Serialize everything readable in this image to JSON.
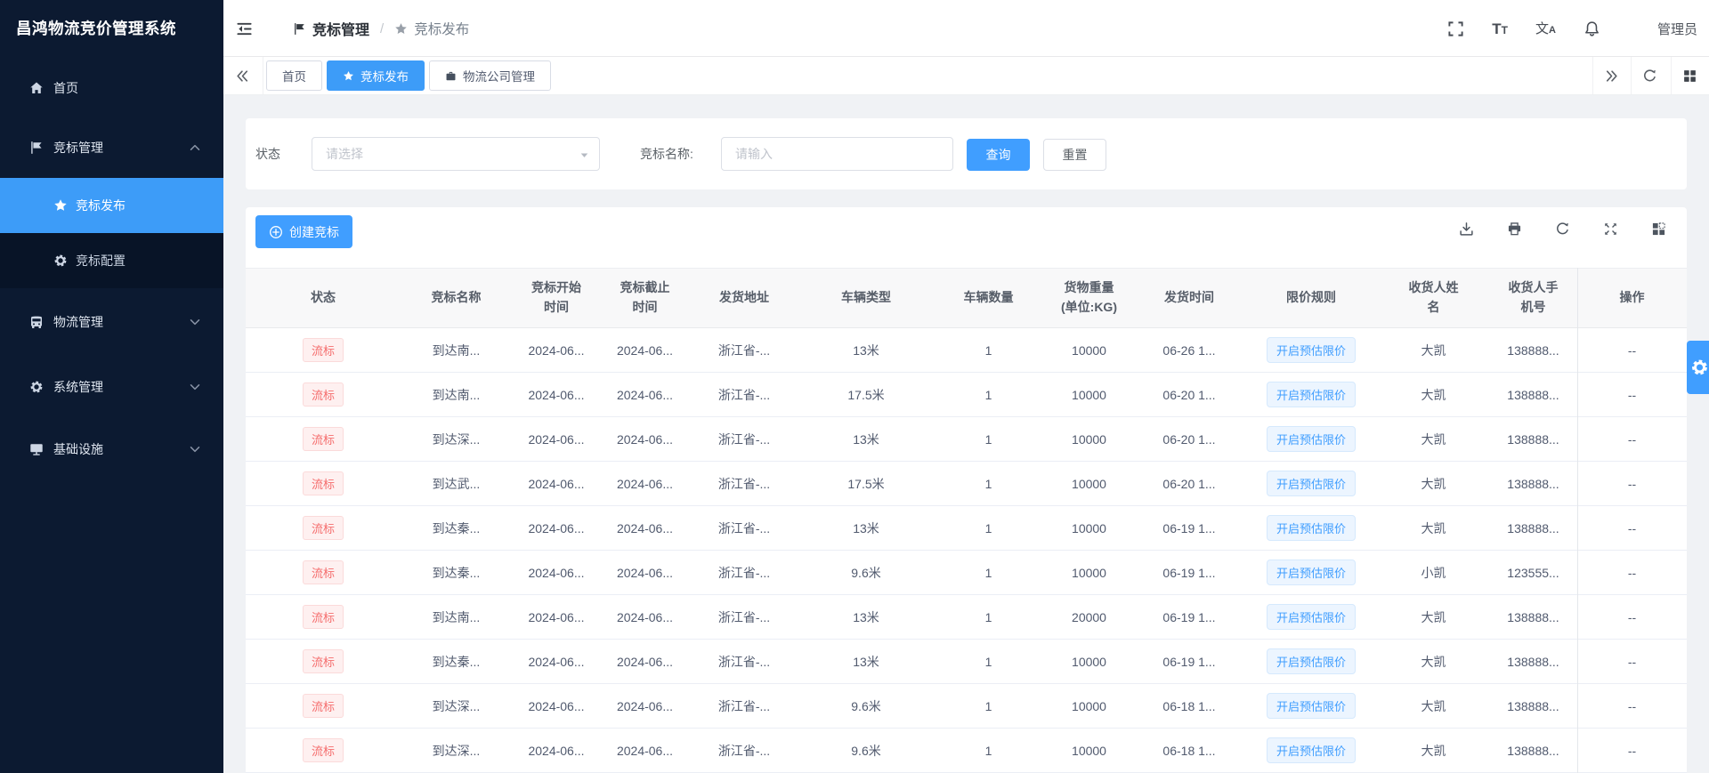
{
  "app": {
    "title": "昌鸿物流竞价管理系统",
    "user": "管理员"
  },
  "breadcrumb": {
    "parent": "竞标管理",
    "separator": "/",
    "current": "竞标发布"
  },
  "sidebar": {
    "items": [
      {
        "label": "首页",
        "icon": "home",
        "type": "top"
      },
      {
        "label": "竞标管理",
        "icon": "flag",
        "type": "top",
        "expanded": true
      },
      {
        "label": "竞标发布",
        "icon": "star",
        "type": "sub",
        "active": true
      },
      {
        "label": "竞标配置",
        "icon": "gear",
        "type": "sub"
      },
      {
        "label": "物流管理",
        "icon": "bus",
        "type": "top",
        "collapsed": true
      },
      {
        "label": "系统管理",
        "icon": "gear",
        "type": "top",
        "collapsed": true
      },
      {
        "label": "基础设施",
        "icon": "monitor",
        "type": "top",
        "collapsed": true
      }
    ]
  },
  "tabs": [
    {
      "label": "首页"
    },
    {
      "label": "竞标发布",
      "icon": "star",
      "active": true
    },
    {
      "label": "物流公司管理",
      "icon": "briefcase"
    }
  ],
  "filters": {
    "status_label": "状态",
    "status_placeholder": "请选择",
    "name_label": "竞标名称:",
    "name_placeholder": "请输入",
    "search_button": "查询",
    "reset_button": "重置"
  },
  "toolbar": {
    "create_button": "创建竞标"
  },
  "table": {
    "columns": [
      [
        "状态"
      ],
      [
        "竞标名称"
      ],
      [
        "竞标开始",
        "时间"
      ],
      [
        "竞标截止",
        "时间"
      ],
      [
        "发货地址"
      ],
      [
        "车辆类型"
      ],
      [
        "车辆数量"
      ],
      [
        "货物重量",
        "(单位:KG)"
      ],
      [
        "发货时间"
      ],
      [
        "限价规则"
      ],
      [
        "收货人姓",
        "名"
      ],
      [
        "收货人手",
        "机号"
      ],
      [
        "操作"
      ]
    ],
    "rows": [
      [
        "流标",
        "到达南...",
        "2024-06...",
        "2024-06...",
        "浙江省-...",
        "13米",
        "1",
        "10000",
        "06-26 1...",
        "开启预估限价",
        "大凯",
        "138888...",
        "--"
      ],
      [
        "流标",
        "到达南...",
        "2024-06...",
        "2024-06...",
        "浙江省-...",
        "17.5米",
        "1",
        "10000",
        "06-20 1...",
        "开启预估限价",
        "大凯",
        "138888...",
        "--"
      ],
      [
        "流标",
        "到达深...",
        "2024-06...",
        "2024-06...",
        "浙江省-...",
        "13米",
        "1",
        "10000",
        "06-20 1...",
        "开启预估限价",
        "大凯",
        "138888...",
        "--"
      ],
      [
        "流标",
        "到达武...",
        "2024-06...",
        "2024-06...",
        "浙江省-...",
        "17.5米",
        "1",
        "10000",
        "06-20 1...",
        "开启预估限价",
        "大凯",
        "138888...",
        "--"
      ],
      [
        "流标",
        "到达秦...",
        "2024-06...",
        "2024-06...",
        "浙江省-...",
        "13米",
        "1",
        "10000",
        "06-19 1...",
        "开启预估限价",
        "大凯",
        "138888...",
        "--"
      ],
      [
        "流标",
        "到达秦...",
        "2024-06...",
        "2024-06...",
        "浙江省-...",
        "9.6米",
        "1",
        "10000",
        "06-19 1...",
        "开启预估限价",
        "小凯",
        "123555...",
        "--"
      ],
      [
        "流标",
        "到达南...",
        "2024-06...",
        "2024-06...",
        "浙江省-...",
        "13米",
        "1",
        "20000",
        "06-19 1...",
        "开启预估限价",
        "大凯",
        "138888...",
        "--"
      ],
      [
        "流标",
        "到达秦...",
        "2024-06...",
        "2024-06...",
        "浙江省-...",
        "13米",
        "1",
        "10000",
        "06-19 1...",
        "开启预估限价",
        "大凯",
        "138888...",
        "--"
      ],
      [
        "流标",
        "到达深...",
        "2024-06...",
        "2024-06...",
        "浙江省-...",
        "9.6米",
        "1",
        "10000",
        "06-18 1...",
        "开启预估限价",
        "大凯",
        "138888...",
        "--"
      ],
      [
        "流标",
        "到达深...",
        "2024-06...",
        "2024-06...",
        "浙江省-...",
        "9.6米",
        "1",
        "10000",
        "06-18 1...",
        "开启预估限价",
        "大凯",
        "138888...",
        "--"
      ]
    ]
  },
  "colors": {
    "primary": "#409eff",
    "sidebar_bg": "#0c1a31",
    "danger": "#f56c6c"
  }
}
